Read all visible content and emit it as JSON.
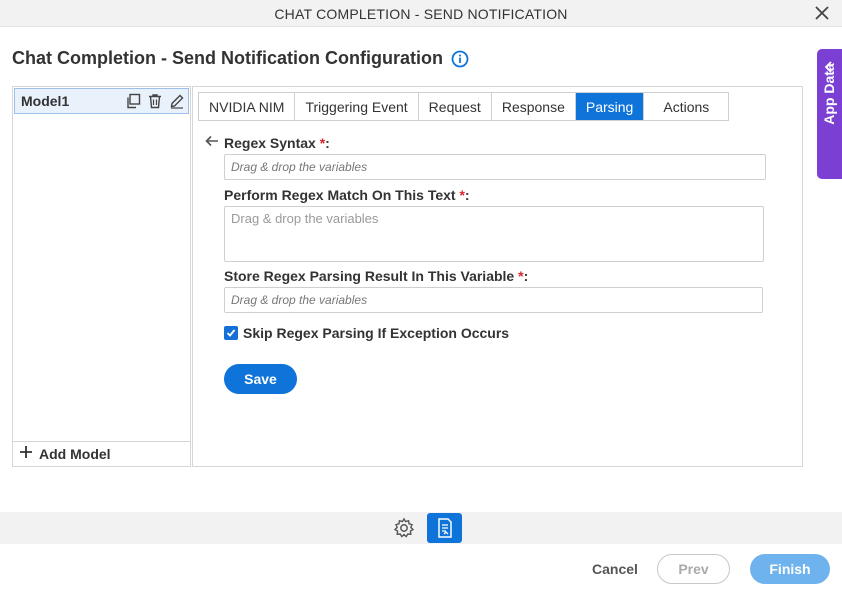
{
  "window": {
    "title": "CHAT COMPLETION - SEND NOTIFICATION",
    "close_icon": "close-icon"
  },
  "page": {
    "title": "Chat Completion - Send Notification Configuration"
  },
  "app_data": {
    "label": "App Data"
  },
  "models": {
    "items": [
      {
        "label": "Model1"
      }
    ],
    "add_label": "Add Model"
  },
  "tabs": [
    {
      "label": "NVIDIA NIM",
      "active": false
    },
    {
      "label": "Triggering Event",
      "active": false
    },
    {
      "label": "Request",
      "active": false
    },
    {
      "label": "Response",
      "active": false
    },
    {
      "label": "Parsing",
      "active": true
    },
    {
      "label": "Actions",
      "active": false
    }
  ],
  "form": {
    "regex_syntax": {
      "label": "Regex Syntax",
      "required_mark": "*",
      "suffix": ":",
      "placeholder": "Drag & drop the variables"
    },
    "match_text": {
      "label": "Perform Regex Match On This Text",
      "required_mark": "*",
      "suffix": ":",
      "placeholder": "Drag & drop the variables"
    },
    "store_result": {
      "label": "Store Regex Parsing Result In This Variable",
      "required_mark": "*",
      "suffix": ":",
      "placeholder": "Drag & drop the variables"
    },
    "skip_exception": {
      "label": "Skip Regex Parsing If Exception Occurs",
      "checked": true
    },
    "save_label": "Save"
  },
  "footer": {
    "cancel": "Cancel",
    "prev": "Prev",
    "finish": "Finish"
  },
  "colors": {
    "primary": "#0f74d9",
    "app_data": "#7b3fd4",
    "required": "#d9262b"
  }
}
